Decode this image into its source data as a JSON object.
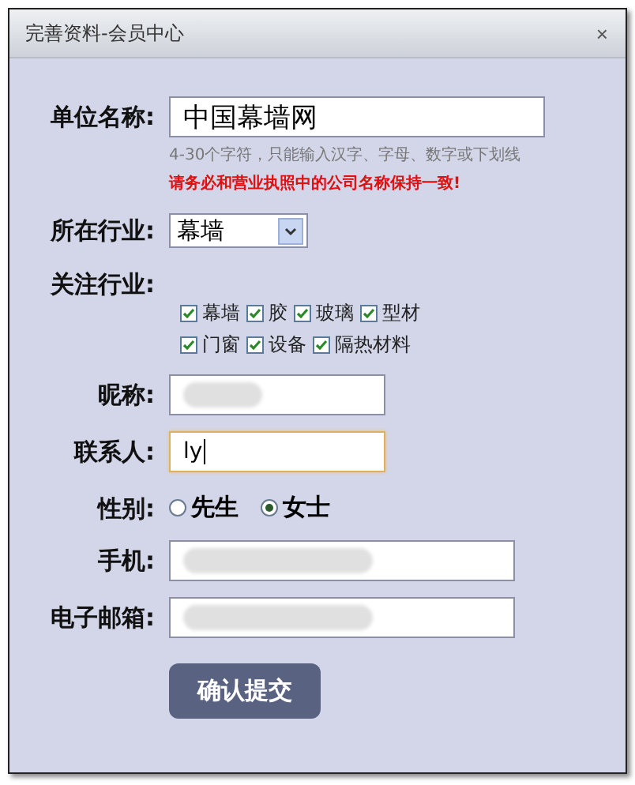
{
  "window": {
    "title": "完善资料-会员中心",
    "close": "×"
  },
  "form": {
    "company": {
      "label": "单位名称:",
      "value": "中国幕墙网",
      "hint": "4-30个字符，只能输入汉字、字母、数字或下划线",
      "warning": "请务必和营业执照中的公司名称保持一致!"
    },
    "industry": {
      "label": "所在行业:",
      "value": "幕墙"
    },
    "interests": {
      "label": "关注行业:",
      "rows": [
        [
          {
            "label": "幕墙",
            "checked": true
          },
          {
            "label": "胶",
            "checked": true
          },
          {
            "label": "玻璃",
            "checked": true
          },
          {
            "label": "型材",
            "checked": true
          }
        ],
        [
          {
            "label": "门窗",
            "checked": true
          },
          {
            "label": "设备",
            "checked": true
          },
          {
            "label": "隔热材料",
            "checked": true
          }
        ]
      ]
    },
    "nickname": {
      "label": "昵称:",
      "redacted": true,
      "focused": false,
      "kind": "short"
    },
    "contact": {
      "label": "联系人:",
      "value": "ly",
      "focused": true,
      "kind": "short"
    },
    "gender": {
      "label": "性别:",
      "options": [
        {
          "label": "先生",
          "selected": false
        },
        {
          "label": "女士",
          "selected": true
        }
      ]
    },
    "mobile": {
      "label": "手机:",
      "redacted": true,
      "focused": false,
      "kind": "long"
    },
    "email": {
      "label": "电子邮箱:",
      "redacted": true,
      "focused": false,
      "kind": "long"
    },
    "submit": "确认提交"
  }
}
